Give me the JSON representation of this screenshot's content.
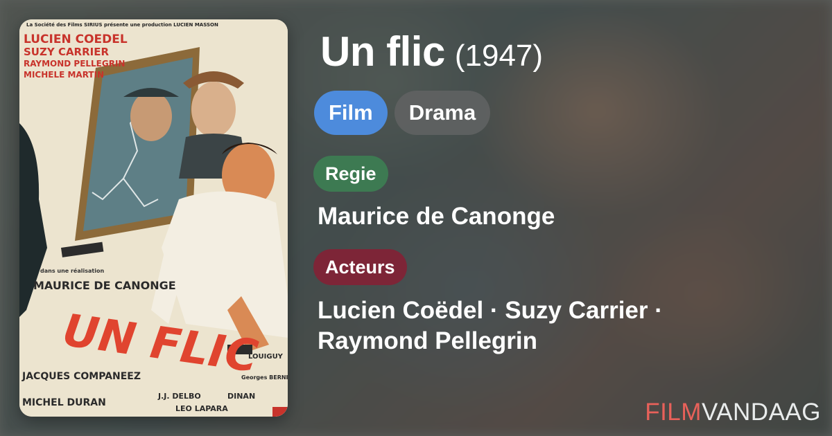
{
  "movie": {
    "title": "Un flic",
    "year": "(1947)",
    "type_tag": "Film",
    "genre_tag": "Drama"
  },
  "director": {
    "label": "Regie",
    "name": "Maurice de Canonge"
  },
  "cast": {
    "label": "Acteurs",
    "line1": "Lucien Coëdel · Suzy Carrier ·",
    "line2": "Raymond Pellegrin"
  },
  "brand": {
    "part1": "FILM",
    "part2": "VANDAAG"
  },
  "poster": {
    "credit_line": "La Société des Films SIRIUS présente une production LUCIEN MASSON",
    "cast_names": [
      "LUCIEN COEDEL",
      "SUZY CARRIER",
      "RAYMOND PELLEGRIN",
      "MICHELE MARTIN"
    ],
    "realisation_label": "dans une réalisation",
    "director": "MAURICE DE CANONGE",
    "title": "UN FLIC",
    "credit_left_1": "JACQUES COMPANEEZ",
    "credit_left_2": "MICHEL DURAN",
    "credit_mid_1": "J.J. DELBO",
    "credit_mid_2": "DINAN",
    "credit_mid_3": "LEO LAPARA",
    "credit_right_1": "LOUIGUY",
    "credit_right_2": "Georges BERNI"
  },
  "colors": {
    "film_tag": "#4d8bdc",
    "regie_pill": "#3d7a52",
    "acteurs_pill": "#7d2537",
    "brand_red": "#e8615a"
  }
}
